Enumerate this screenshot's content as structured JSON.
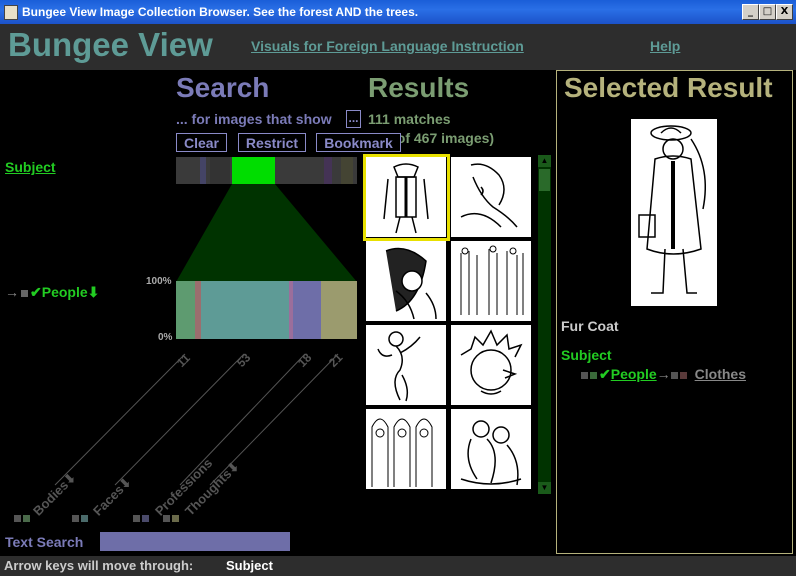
{
  "window": {
    "title": "Bungee View Image Collection Browser.  See the forest AND the trees.",
    "minimize": "_",
    "maximize": "□",
    "close": "X"
  },
  "header": {
    "brand": "Bungee View",
    "collection_link": "Visuals for Foreign Language Instruction",
    "help_link": "Help"
  },
  "search": {
    "heading": "Search",
    "subtitle": "... for images that show",
    "ellipsis_button": "...",
    "buttons": {
      "clear": "Clear",
      "restrict": "Restrict",
      "bookmark": "Bookmark"
    },
    "facet_label": "Subject",
    "selected_facet": "People",
    "y_ticks": {
      "top": "100%",
      "bottom": "0%"
    },
    "bars": [
      {
        "label": "Bodies",
        "count": "11",
        "color": "#5e9b70",
        "share": 0.1
      },
      {
        "label": "Faces",
        "count": "53",
        "color": "#5e9b96",
        "share": 0.5
      },
      {
        "label": "Professions",
        "count": "18",
        "color": "#6e6ea8",
        "share": 0.17
      },
      {
        "label": "Thoughts",
        "count": "21",
        "color": "#9b9b6e",
        "share": 0.2
      }
    ],
    "text_search_label": "Text Search",
    "text_search_value": ""
  },
  "results": {
    "heading": "Results",
    "matches": "111 matches",
    "range": "(1-8 of 467 images)"
  },
  "selected": {
    "heading": "Selected Result",
    "caption": "Fur Coat",
    "facet_label": "Subject",
    "path_people": "People",
    "path_clothes": "Clothes"
  },
  "status": {
    "prefix": "Arrow keys will move through:",
    "value": "Subject"
  },
  "colors": {
    "accent_teal": "#5e9b96",
    "search_purple": "#7b7bb8",
    "results_green": "#7b9d72",
    "selected_olive": "#b5b27c",
    "bright_green": "#22cc22",
    "selection_yellow": "#e8e000"
  },
  "icons": [
    "check-icon",
    "down-arrow-icon",
    "right-arrow-icon",
    "square-icon"
  ]
}
